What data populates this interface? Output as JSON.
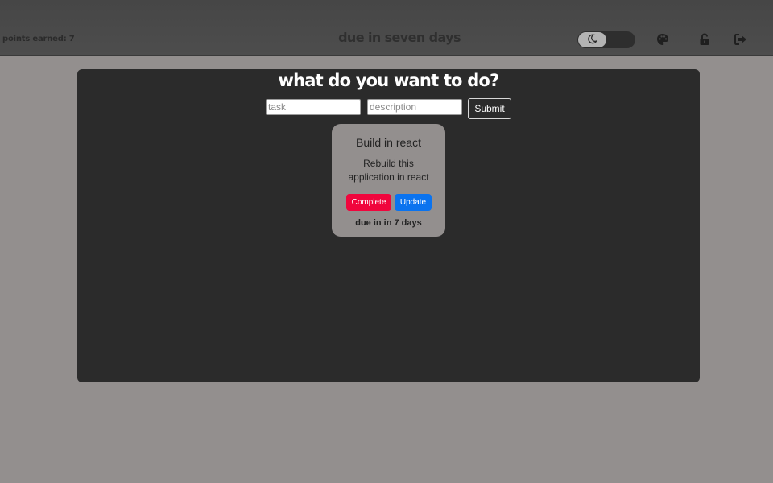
{
  "header": {
    "points_label": "points earned: 7",
    "title": "due in seven days",
    "theme_toggle_icon": "moon-icon",
    "icons": [
      "palette-icon",
      "unlock-icon",
      "logout-icon"
    ]
  },
  "main": {
    "heading": "what do you want to do?",
    "form": {
      "task_placeholder": "task",
      "task_value": "",
      "description_placeholder": "description",
      "description_value": "",
      "submit_label": "Submit"
    },
    "tasks": [
      {
        "title": "Build in react",
        "description": "Rebuild this application in react",
        "complete_label": "Complete",
        "update_label": "Update",
        "due": "due in in 7 days"
      }
    ]
  },
  "colors": {
    "page_background": "#938f8e",
    "header_background": "#4a4a4a",
    "panel_background": "#2b2b2b",
    "complete_button": "#f0063d",
    "update_button": "#0a73ef"
  }
}
